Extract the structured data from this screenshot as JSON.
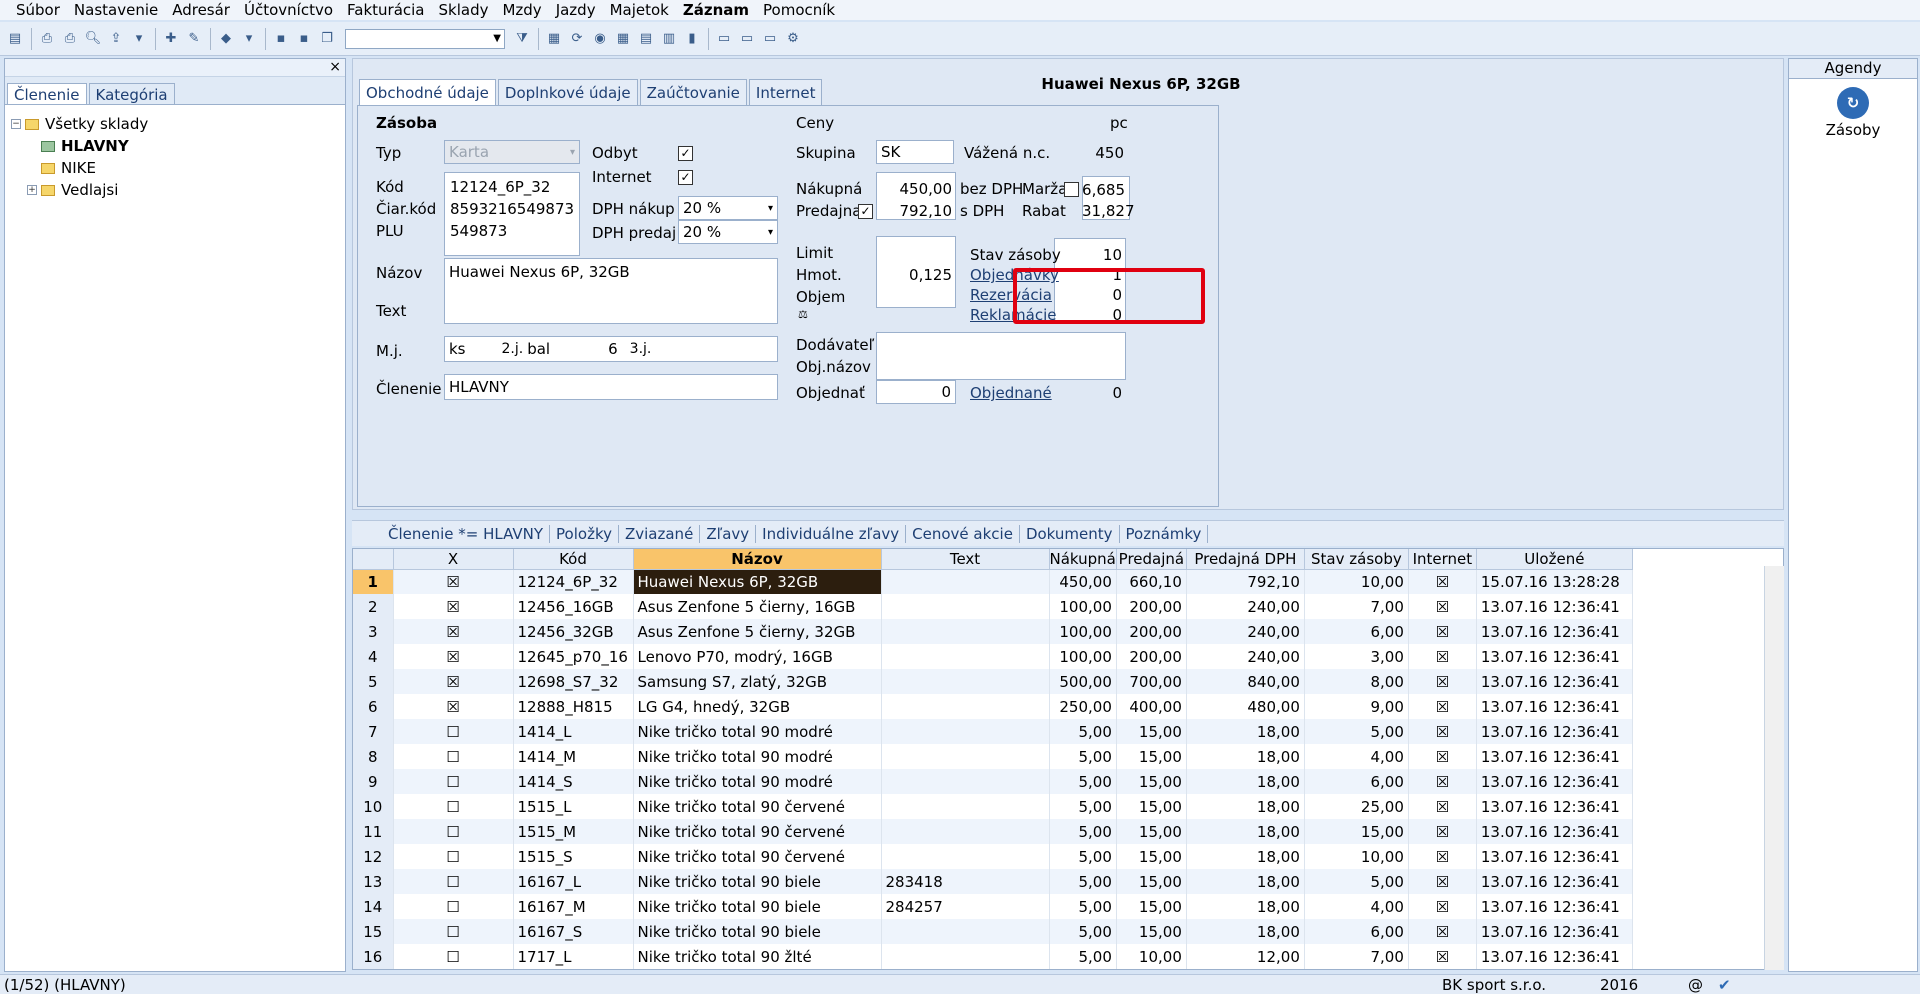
{
  "menu": [
    "Súbor",
    "Nastavenie",
    "Adresár",
    "Účtovníctvo",
    "Fakturácia",
    "Sklady",
    "Mzdy",
    "Jazdy",
    "Majetok",
    "Záznam",
    "Pomocník"
  ],
  "left": {
    "tabs": [
      "Členenie",
      "Kategória"
    ],
    "tree": {
      "root": "Všetky sklady",
      "items": [
        "HLAVNY",
        "NIKE",
        "Vedlajsi"
      ]
    }
  },
  "form": {
    "tabs": [
      "Obchodné údaje",
      "Doplnkové údaje",
      "Zaúčtovanie",
      "Internet"
    ],
    "title": "Huawei Nexus 6P, 32GB",
    "section": "Zásoba",
    "typ_label": "Typ",
    "typ_value": "Karta",
    "odbyt_label": "Odbyt",
    "internet_label": "Internet",
    "kod_label": "Kód",
    "kod": "12124_6P_32",
    "ciar_label": "Čiar.kód",
    "ciar": "8593216549873",
    "plu_label": "PLU",
    "plu": "549873",
    "dph_nakup_label": "DPH nákup",
    "dph_nakup": "20 %",
    "dph_predaj_label": "DPH predaj",
    "dph_predaj": "20 %",
    "nazov_label": "Názov",
    "nazov": "Huawei Nexus 6P, 32GB",
    "text_label": "Text",
    "mj_label": "M.j.",
    "mj": "ks",
    "mj2_label": "2.j.",
    "mj2": "bal",
    "mj2_qty": "6",
    "mj3_label": "3.j.",
    "clenenie_label": "Členenie",
    "clenenie": "HLAVNY",
    "ceny_label": "Ceny",
    "pc": "pc",
    "skupina_label": "Skupina",
    "skupina": "SK",
    "vazena_label": "Vážená n.c.",
    "vazena": "450",
    "nakupna_label": "Nákupná",
    "nakupna": "450,00",
    "bez_dph": "bez DPH",
    "marza_label": "Marža",
    "marza": "46,685",
    "predajna_label": "Predajna",
    "predajna": "792,10",
    "s_dph": "s DPH",
    "rabat_label": "Rabat",
    "rabat": "31,827",
    "limit_label": "Limit",
    "hmot_label": "Hmot.",
    "hmot": "0,125",
    "objem_label": "Objem",
    "stav_label": "Stav zásoby",
    "stav": "10",
    "objednavky_label": "Objednávky",
    "objednavky": "1",
    "rezervacia_label": "Rezervácia",
    "rezervacia": "0",
    "reklamacie_label": "Reklamácie",
    "reklamacie": "0",
    "dodavatel_label": "Dodávateľ",
    "objnazov_label": "Obj.názov",
    "objednat_label": "Objednať",
    "objednat": "0",
    "objednane_label": "Objednané",
    "objednane": "0"
  },
  "grid_tabs": [
    "Členenie *= HLAVNY",
    "Položky",
    "Zviazané",
    "Zľavy",
    "Individuálne zľavy",
    "Cenové akcie",
    "Dokumenty",
    "Poznámky"
  ],
  "grid": {
    "columns": [
      "",
      "X",
      "Kód",
      "Názov",
      "Text",
      "Nákupná",
      "Predajná",
      "Predajná DPH",
      "Stav zásoby",
      "Internet",
      "Uložené"
    ],
    "rows": [
      [
        "1",
        "☒",
        "12124_6P_32",
        "Huawei Nexus 6P, 32GB",
        "",
        "450,00",
        "660,10",
        "792,10",
        "10,00",
        "☒",
        "15.07.16 13:28:28"
      ],
      [
        "2",
        "☒",
        "12456_16GB",
        "Asus Zenfone 5 čierny, 16GB",
        "",
        "100,00",
        "200,00",
        "240,00",
        "7,00",
        "☒",
        "13.07.16 12:36:41"
      ],
      [
        "3",
        "☒",
        "12456_32GB",
        "Asus Zenfone 5 čierny, 32GB",
        "",
        "100,00",
        "200,00",
        "240,00",
        "6,00",
        "☒",
        "13.07.16 12:36:41"
      ],
      [
        "4",
        "☒",
        "12645_p70_16",
        "Lenovo P70, modrý, 16GB",
        "",
        "100,00",
        "200,00",
        "240,00",
        "3,00",
        "☒",
        "13.07.16 12:36:41"
      ],
      [
        "5",
        "☒",
        "12698_S7_32",
        "Samsung S7, zlatý, 32GB",
        "",
        "500,00",
        "700,00",
        "840,00",
        "8,00",
        "☒",
        "13.07.16 12:36:41"
      ],
      [
        "6",
        "☒",
        "12888_H815",
        "LG G4, hnedý, 32GB",
        "",
        "250,00",
        "400,00",
        "480,00",
        "9,00",
        "☒",
        "13.07.16 12:36:41"
      ],
      [
        "7",
        "☐",
        "1414_L",
        "Nike tričko total 90 modré",
        "",
        "5,00",
        "15,00",
        "18,00",
        "5,00",
        "☒",
        "13.07.16 12:36:41"
      ],
      [
        "8",
        "☐",
        "1414_M",
        "Nike tričko total 90 modré",
        "",
        "5,00",
        "15,00",
        "18,00",
        "4,00",
        "☒",
        "13.07.16 12:36:41"
      ],
      [
        "9",
        "☐",
        "1414_S",
        "Nike tričko total 90 modré",
        "",
        "5,00",
        "15,00",
        "18,00",
        "6,00",
        "☒",
        "13.07.16 12:36:41"
      ],
      [
        "10",
        "☐",
        "1515_L",
        "Nike tričko total 90 červené",
        "",
        "5,00",
        "15,00",
        "18,00",
        "25,00",
        "☒",
        "13.07.16 12:36:41"
      ],
      [
        "11",
        "☐",
        "1515_M",
        "Nike tričko total 90 červené",
        "",
        "5,00",
        "15,00",
        "18,00",
        "15,00",
        "☒",
        "13.07.16 12:36:41"
      ],
      [
        "12",
        "☐",
        "1515_S",
        "Nike tričko total 90 červené",
        "",
        "5,00",
        "15,00",
        "18,00",
        "10,00",
        "☒",
        "13.07.16 12:36:41"
      ],
      [
        "13",
        "☐",
        "16167_L",
        "Nike tričko total 90 biele",
        "283418",
        "5,00",
        "15,00",
        "18,00",
        "5,00",
        "☒",
        "13.07.16 12:36:41"
      ],
      [
        "14",
        "☐",
        "16167_M",
        "Nike tričko total 90 biele",
        "284257",
        "5,00",
        "15,00",
        "18,00",
        "4,00",
        "☒",
        "13.07.16 12:36:41"
      ],
      [
        "15",
        "☐",
        "16167_S",
        "Nike tričko total 90 biele",
        "",
        "5,00",
        "15,00",
        "18,00",
        "6,00",
        "☒",
        "13.07.16 12:36:41"
      ],
      [
        "16",
        "☐",
        "1717_L",
        "Nike tričko total 90 žlté",
        "",
        "5,00",
        "10,00",
        "12,00",
        "7,00",
        "☒",
        "13.07.16 12:36:41"
      ]
    ]
  },
  "right": {
    "header": "Agendy",
    "item": "Zásoby"
  },
  "status": {
    "left": "(1/52) (HLAVNY)",
    "company": "BK sport  s.r.o.",
    "year": "2016",
    "at": "@"
  }
}
